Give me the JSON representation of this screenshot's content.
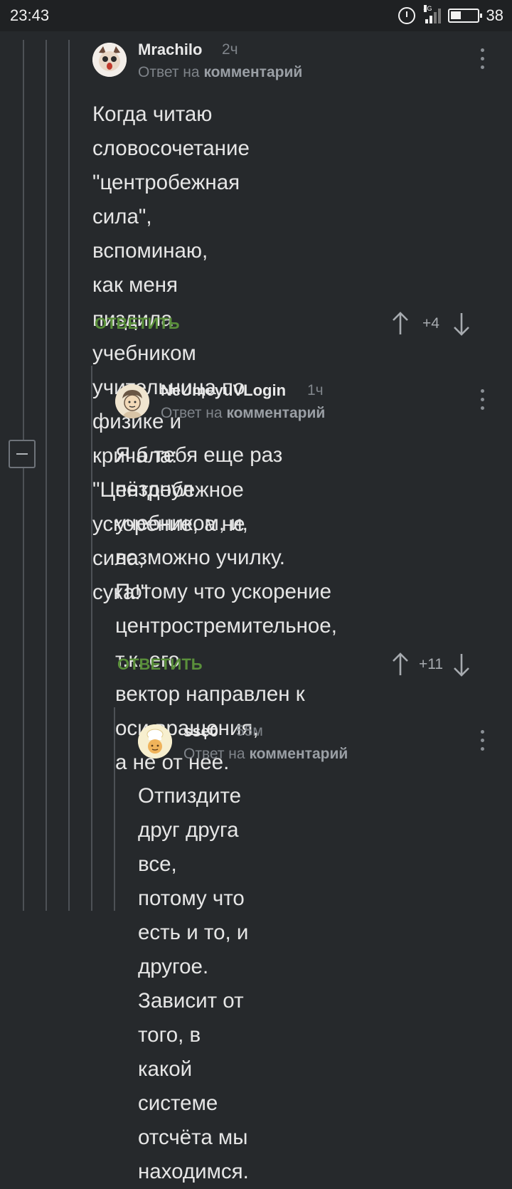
{
  "status": {
    "time": "23:43",
    "battery": "38",
    "network": "4G"
  },
  "comments": [
    {
      "author": "Mrachilo",
      "time": "2ч",
      "reply_prefix": "Ответ на",
      "reply_link": "комментарий",
      "lines": [
        "Когда читаю словосочетание",
        "\"центробежная сила\", вспоминаю,",
        "как меня пиздила учебником",
        "учительница по физике и кричала:",
        "\"Центробежное ускорение, а не сила,",
        "сука!\""
      ],
      "reply_label": "ОТВЕТИТЬ",
      "score": "+4"
    },
    {
      "author": "NeUmeyuVLogin",
      "time": "1ч",
      "reply_prefix": "Ответ на",
      "reply_link": "комментарий",
      "lines": [
        "Я б тебя еще раз пёзднул",
        "учебником, и, возможно училку.",
        "Потому что ускорение",
        "центростремительное, т.к. его",
        "вектор направлен к оси вращения,",
        "а не от нее."
      ],
      "reply_label": "ОТВЕТИТЬ",
      "score": "+11"
    },
    {
      "author": "sse0",
      "time": "55м",
      "reply_prefix": "Ответ на",
      "reply_link": "комментарий",
      "lines": [
        "Отпиздите друг друга все,",
        "потому что есть и то, и другое.",
        "Зависит от того, в какой системе",
        "отсчёта мы находимся."
      ]
    }
  ]
}
